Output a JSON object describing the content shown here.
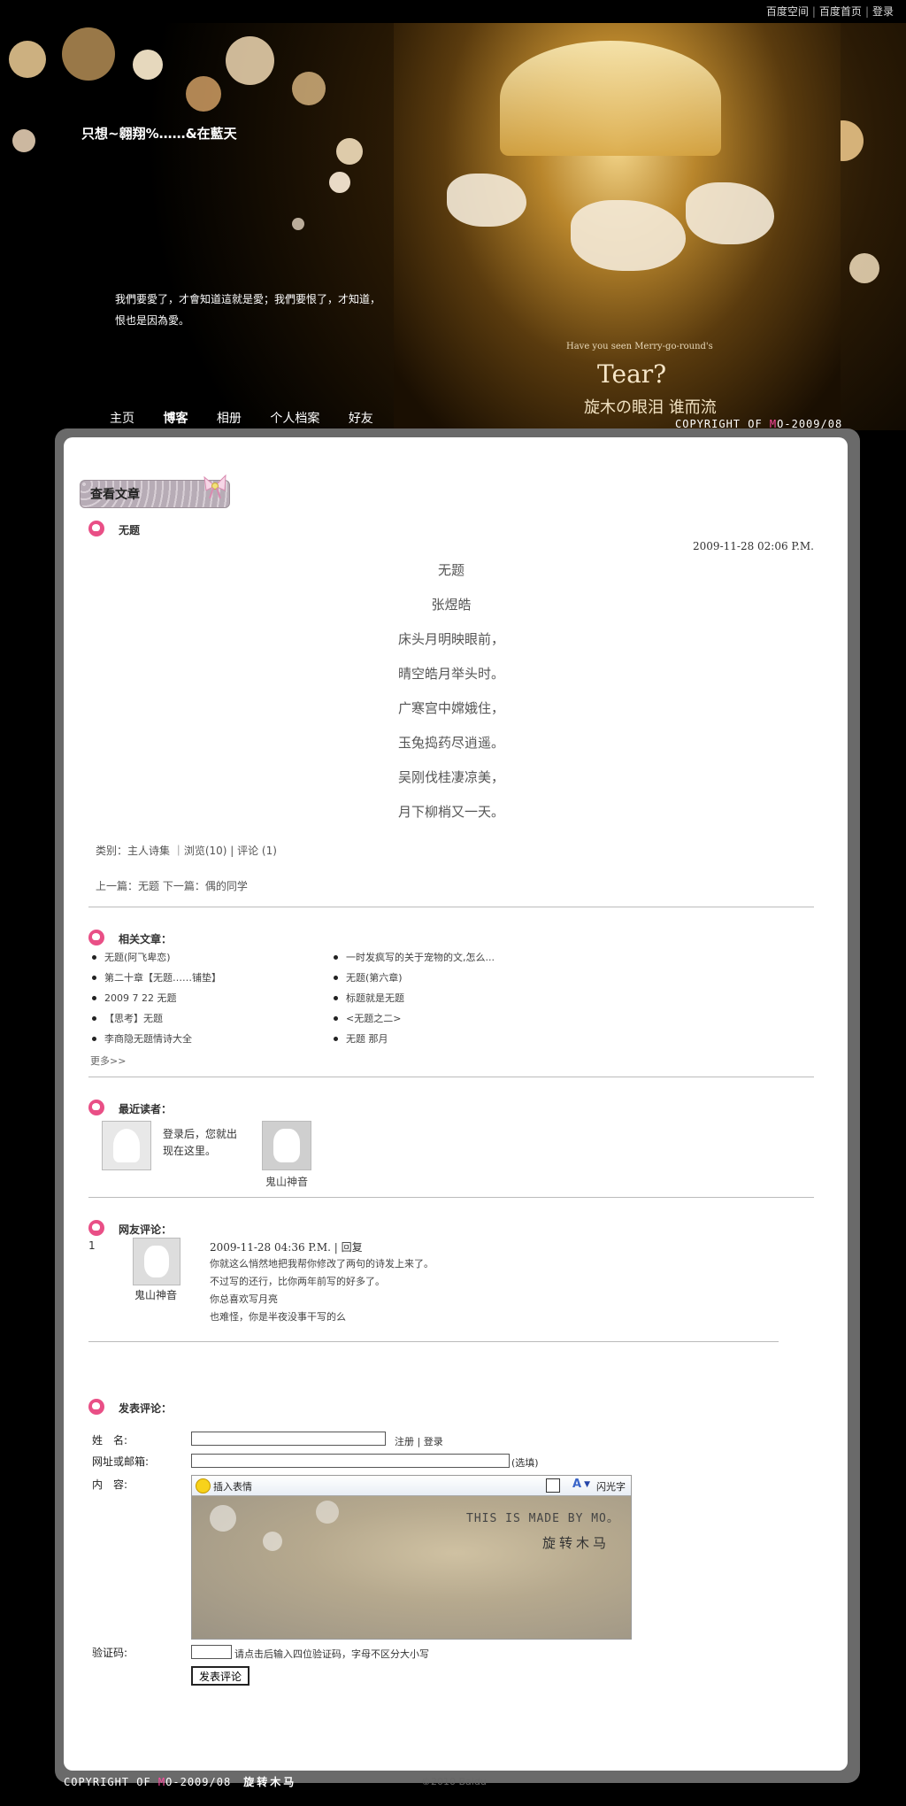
{
  "topbar": {
    "links": [
      "百度空间",
      "百度首页",
      "登录"
    ]
  },
  "header": {
    "blog_title": "只想~翱翔%……&在藍天",
    "motto": "我們要愛了，才會知道這就是愛；我們要恨了，才知道，恨也是因為愛。",
    "nav": [
      "主页",
      "博客",
      "相册",
      "个人档案",
      "好友"
    ],
    "nav_active": "博客",
    "copyright_prefix": "COPYRIGHT OF ",
    "copyright_m": "M",
    "copyright_suffix": "O-2009/08",
    "art_text": {
      "line1": "Have you seen Merry-go-round's",
      "line2": "Tear?",
      "line3": "旋木の眼泪 谁而流"
    }
  },
  "section": {
    "title": "查看文章"
  },
  "article": {
    "title": "无题",
    "date": "2009-11-28 02:06 P.M.",
    "lines": [
      "无题",
      "张煜皓",
      "床头月明映眼前，",
      "晴空皓月举头时。",
      "广寒宫中嫦娥住，",
      "玉兔捣药尽逍遥。",
      "吴刚伐桂凄凉美，",
      "月下柳梢又一天。"
    ],
    "meta": "类别：主人诗集 ｜浏览(10) | 评论 (1)",
    "prev_next": "上一篇：无题    下一篇：偶的同学"
  },
  "related": {
    "heading": "相关文章：",
    "left": [
      "无题(阿飞卑恋)",
      "第二十章【无题……铺垫】",
      "2009 7 22 无题",
      "【思考】无题",
      "李商隐无题情诗大全"
    ],
    "right": [
      "一时发疯写的关于宠物的文,怎么...",
      "无题(第六章)",
      "标题就是无题",
      "<无题之二>",
      "无题 那月"
    ],
    "more": "更多>>"
  },
  "readers": {
    "heading": "最近读者：",
    "login_tip": "登录后，您就出现在这里。",
    "reader_name": "鬼山神音"
  },
  "comments": {
    "heading": "网友评论：",
    "items": [
      {
        "num": "1",
        "name": "鬼山神音",
        "date": "2009-11-28 04:36 P.M.",
        "reply": "回复",
        "lines": [
          "你就这么悄然地把我帮你修改了两句的诗发上来了。",
          "不过写的还行，比你两年前写的好多了。",
          "你总喜欢写月亮",
          "也难怪，你是半夜没事干写的么"
        ]
      }
    ]
  },
  "form": {
    "heading": "发表评论：",
    "name_label": "姓　名:",
    "register": "注册",
    "login": "登录",
    "url_label": "网址或邮箱:",
    "optional": "(选填)",
    "content_label": "内　容:",
    "insert_emoji": "插入表情",
    "flash_text": "闪光字",
    "editor_bg_text1": "THIS IS MADE BY MO。",
    "editor_bg_text2": "旋转木马",
    "captcha_label": "验证码:",
    "captcha_tip": "请点击后输入四位验证码，字母不区分大小写",
    "submit": "发表评论"
  },
  "footer": {
    "copyright_prefix": "COPYRIGHT OF ",
    "copyright_m": "M",
    "copyright_suffix": "O-2009/08",
    "signature": "旋转木马",
    "baidu": "©2010 Baidu"
  }
}
